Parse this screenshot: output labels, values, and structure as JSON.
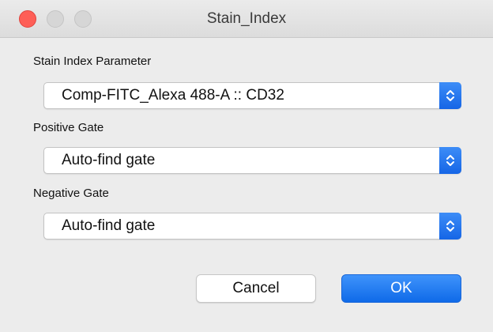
{
  "window": {
    "title": "Stain_Index"
  },
  "form": {
    "parameter_label": "Stain Index Parameter",
    "parameter_value": "Comp-FITC_Alexa 488-A :: CD32",
    "positive_label": "Positive Gate",
    "positive_value": "Auto-find gate",
    "negative_label": "Negative Gate",
    "negative_value": "Auto-find gate"
  },
  "buttons": {
    "cancel_label": "Cancel",
    "ok_label": "OK"
  },
  "colors": {
    "accent": "#1a73f0",
    "close": "#fe5f57",
    "window_bg": "#ececec"
  },
  "icons": {
    "select_arrow": "chevron-up-down-icon"
  }
}
